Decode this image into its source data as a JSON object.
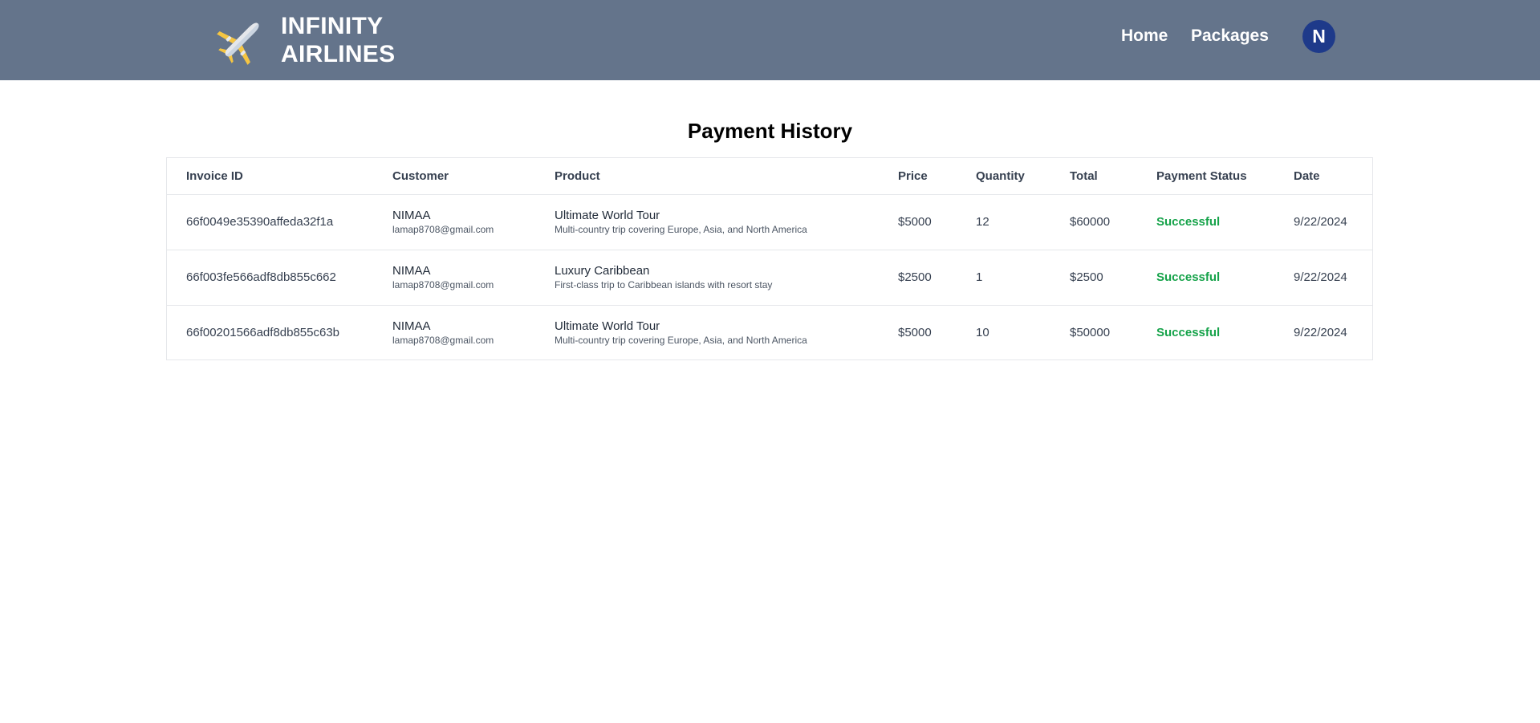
{
  "header": {
    "brand_line1": "INFINITY",
    "brand_line2": "AIRLINES",
    "logo_icon": "airplane-icon",
    "nav": {
      "home": "Home",
      "packages": "Packages"
    },
    "avatar_initial": "N",
    "colors": {
      "background": "#64748b",
      "avatar": "#1e3a8a"
    }
  },
  "page": {
    "title": "Payment History"
  },
  "table": {
    "columns": [
      "Invoice ID",
      "Customer",
      "Product",
      "Price",
      "Quantity",
      "Total",
      "Payment Status",
      "Date"
    ],
    "rows": [
      {
        "invoice_id": "66f0049e35390affeda32f1a",
        "customer_name": "NIMAA",
        "customer_email": "lamap8708@gmail.com",
        "product_name": "Ultimate World Tour",
        "product_desc": "Multi-country trip covering Europe, Asia, and North America",
        "price": "$5000",
        "quantity": "12",
        "total": "$60000",
        "status": "Successful",
        "date": "9/22/2024"
      },
      {
        "invoice_id": "66f003fe566adf8db855c662",
        "customer_name": "NIMAA",
        "customer_email": "lamap8708@gmail.com",
        "product_name": "Luxury Caribbean",
        "product_desc": "First-class trip to Caribbean islands with resort stay",
        "price": "$2500",
        "quantity": "1",
        "total": "$2500",
        "status": "Successful",
        "date": "9/22/2024"
      },
      {
        "invoice_id": "66f00201566adf8db855c63b",
        "customer_name": "NIMAA",
        "customer_email": "lamap8708@gmail.com",
        "product_name": "Ultimate World Tour",
        "product_desc": "Multi-country trip covering Europe, Asia, and North America",
        "price": "$5000",
        "quantity": "10",
        "total": "$50000",
        "status": "Successful",
        "date": "9/22/2024"
      }
    ],
    "colors": {
      "status_success": "#16a34a"
    }
  }
}
